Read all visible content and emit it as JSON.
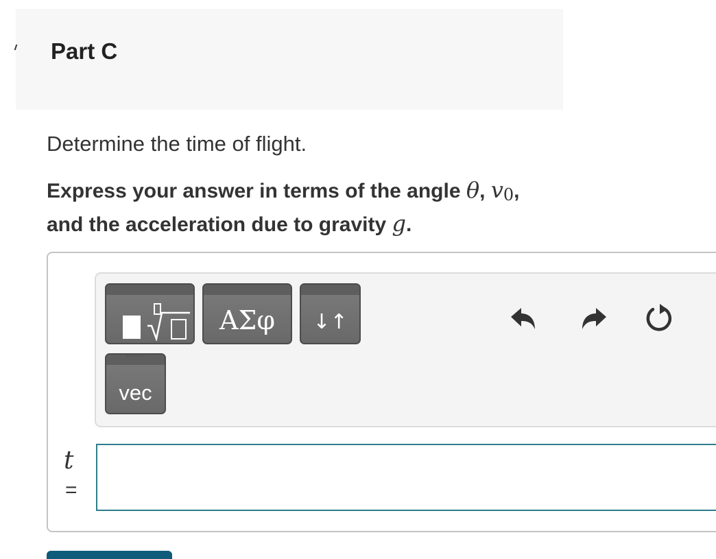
{
  "header": {
    "title": "Part C"
  },
  "question": {
    "text": "Determine the time of flight.",
    "instruction_prefix": "Express your answer in terms of the angle ",
    "theta": "θ",
    "comma_1": ", ",
    "v": "v",
    "v_sub": "0",
    "comma_2": ",",
    "instruction_line2": "and the acceleration due to gravity ",
    "g": "g",
    "period": "."
  },
  "toolbar": {
    "buttons": [
      {
        "name": "templates",
        "icon": "templates-icon"
      },
      {
        "name": "greek",
        "label": "ΑΣφ"
      },
      {
        "name": "arrows",
        "label": "↓↑"
      },
      {
        "name": "vec",
        "label": "vec"
      }
    ],
    "actions": [
      "undo-icon",
      "redo-icon",
      "reset-icon"
    ]
  },
  "answer": {
    "variable": "t",
    "equals": "=",
    "value": ""
  },
  "colors": {
    "accent": "#2d7d8c",
    "button": "#6f6f6f",
    "submit": "#0f5b7a"
  }
}
